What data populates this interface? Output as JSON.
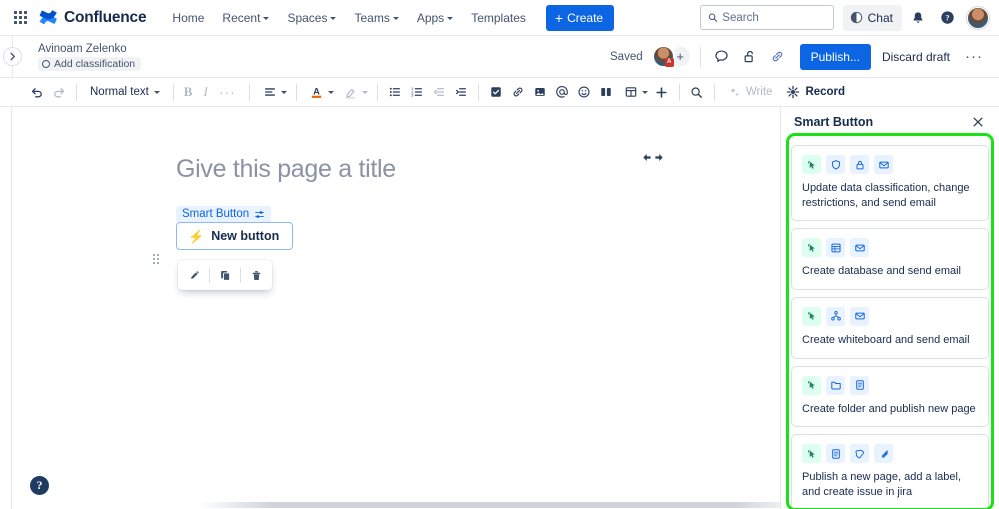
{
  "topnav": {
    "app_switcher": "app-switcher-icon",
    "brand": "Confluence",
    "links": [
      {
        "label": "Home",
        "has_caret": false
      },
      {
        "label": "Recent",
        "has_caret": true
      },
      {
        "label": "Spaces",
        "has_caret": true
      },
      {
        "label": "Teams",
        "has_caret": true
      },
      {
        "label": "Apps",
        "has_caret": true
      },
      {
        "label": "Templates",
        "has_caret": false
      }
    ],
    "create_label": "Create",
    "search_placeholder": "Search",
    "search_value": "",
    "chat_label": "Chat",
    "notifications": "bell-icon",
    "help": "question-circle-icon",
    "profile": "avatar"
  },
  "pageheader": {
    "breadcrumb_user": "Avinoam Zelenko",
    "classification_label": "Add classification",
    "saved_label": "Saved",
    "avatar_badge": "A",
    "add_people": "+",
    "comment_icon": "comment-icon",
    "restrictions_icon": "unlock-icon",
    "link_icon": "link-icon",
    "publish_label": "Publish...",
    "discard_label": "Discard draft",
    "more_label": "···"
  },
  "toolbar": {
    "undo": "undo-icon",
    "redo": "redo-icon",
    "text_style": "Normal text",
    "bold": "B",
    "italic": "I",
    "more_formatting": "···",
    "alignment": "text-align-icon",
    "text_color": "A",
    "highlight": "highlight-icon",
    "bullet_list": "bullet-list-icon",
    "numbered_list": "numbered-list-icon",
    "outdent": "outdent-icon",
    "indent": "indent-icon",
    "task_list": "checkbox-icon",
    "link": "link-icon",
    "image": "image-icon",
    "mention": "at-icon",
    "emoji": "emoji-icon",
    "layouts": "columns-icon",
    "table": "table-icon",
    "insert": "plus-icon",
    "find": "search-icon",
    "write_label": "Write",
    "record_label": "Record"
  },
  "canvas": {
    "title_placeholder": "Give this page a title",
    "resize_handle": "horizontal-resize-icon",
    "smart_chip_label": "Smart Button",
    "smart_chip_icon": "settings-sliders-icon",
    "new_button_label": "New button",
    "new_button_icon": "bolt-icon",
    "node_toolbar": {
      "edit": "pencil-icon",
      "copy": "copy-icon",
      "delete": "trash-icon"
    },
    "help_fab": "?"
  },
  "panel": {
    "title": "Smart Button",
    "close": "close-icon",
    "highlight_color": "#17e317",
    "cards": [
      {
        "icons": [
          "cursor-click-icon",
          "shield-icon",
          "lock-icon",
          "envelope-icon"
        ],
        "icon_tones": [
          "green",
          "blue",
          "blue",
          "blue"
        ],
        "text": "Update data classification, change restrictions, and send email"
      },
      {
        "icons": [
          "cursor-click-icon",
          "database-table-icon",
          "envelope-icon"
        ],
        "icon_tones": [
          "green",
          "blue",
          "blue"
        ],
        "text": "Create database and send email"
      },
      {
        "icons": [
          "cursor-click-icon",
          "whiteboard-icon",
          "envelope-icon"
        ],
        "icon_tones": [
          "green",
          "blue",
          "blue"
        ],
        "text": "Create whiteboard and send email"
      },
      {
        "icons": [
          "cursor-click-icon",
          "folder-icon",
          "page-icon"
        ],
        "icon_tones": [
          "green",
          "blue",
          "blue"
        ],
        "text": "Create folder and publish new page"
      },
      {
        "icons": [
          "cursor-click-icon",
          "page-icon",
          "label-tag-icon",
          "jira-icon"
        ],
        "icon_tones": [
          "green",
          "blue",
          "blue",
          "blue"
        ],
        "text": "Publish a new page, add a label, and create issue in jira"
      }
    ]
  },
  "colors": {
    "brand_blue": "#0C66E4",
    "text": "#172B4D",
    "subtle_text": "#44546F",
    "border": "#dcdfe4",
    "highlight_green": "#17e317",
    "chip_bg": "#E9F2FF"
  }
}
